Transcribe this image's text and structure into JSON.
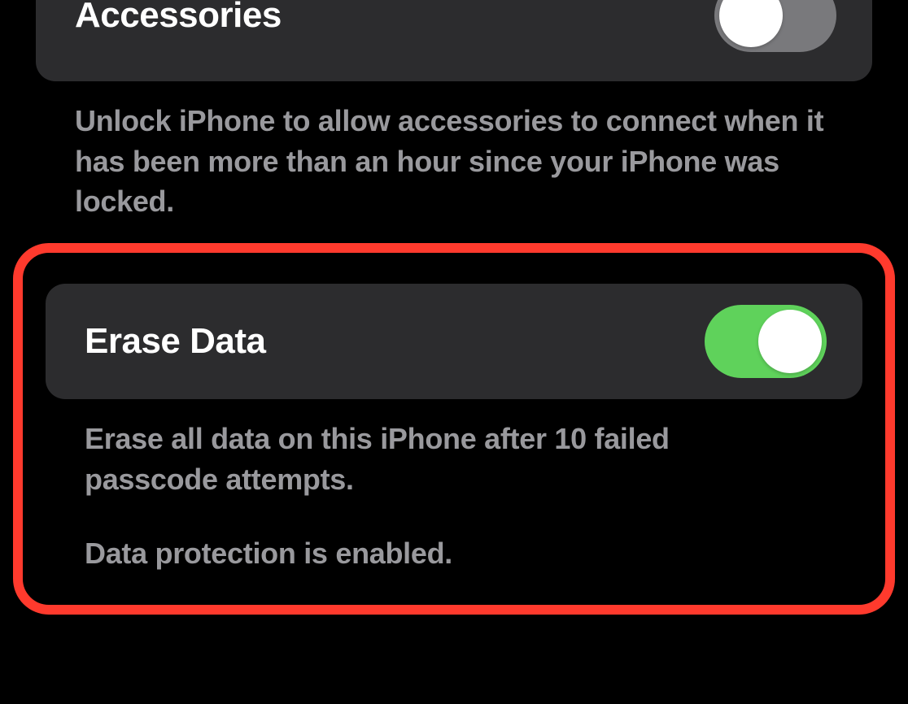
{
  "sections": {
    "accessories": {
      "title": "Accessories",
      "enabled": false,
      "footer": "Unlock iPhone to allow accessories to connect when it has been more than an hour since your iPhone was locked."
    },
    "erase_data": {
      "title": "Erase Data",
      "enabled": true,
      "footer_line1": "Erase all data on this iPhone after 10 failed passcode attempts.",
      "footer_line2": "Data protection is enabled."
    }
  },
  "colors": {
    "toggle_on": "#5fd25b",
    "toggle_off": "#79797c",
    "highlight_border": "#ff3a2d"
  }
}
